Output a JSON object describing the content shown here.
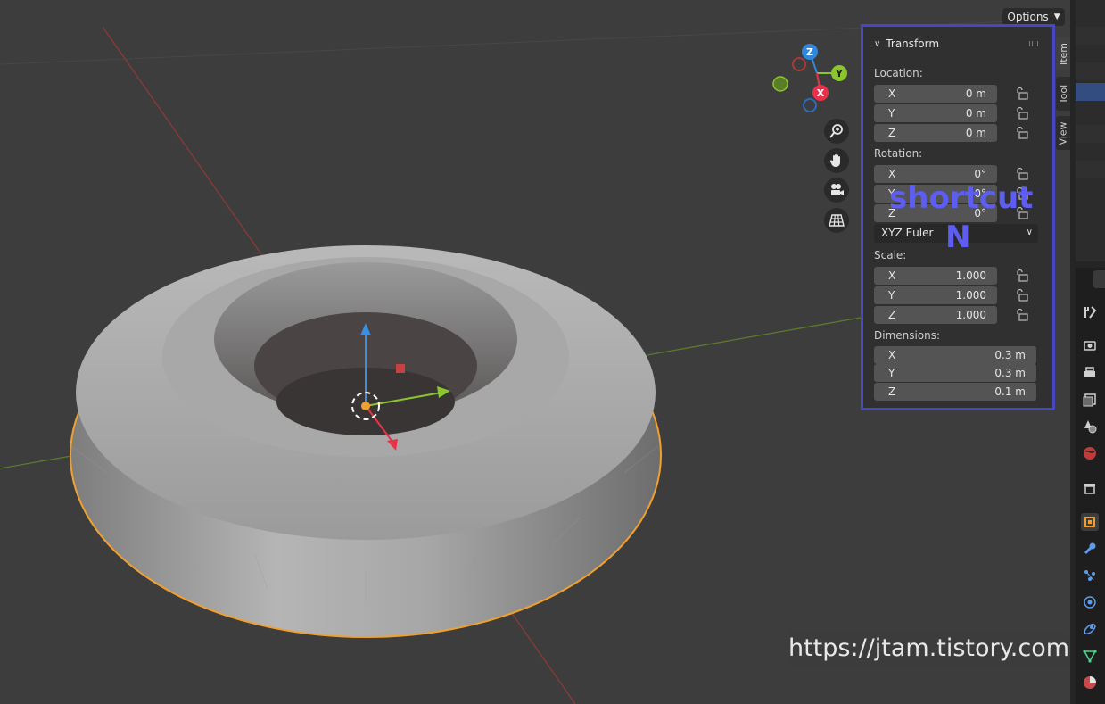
{
  "header": {
    "options_label": "Options"
  },
  "transform": {
    "title": "Transform",
    "location": {
      "label": "Location:",
      "x": "0 m",
      "y": "0 m",
      "z": "0 m"
    },
    "rotation": {
      "label": "Rotation:",
      "x": "0°",
      "y": "0°",
      "z": "0°"
    },
    "rotation_mode": "XYZ Euler",
    "scale": {
      "label": "Scale:",
      "x": "1.000",
      "y": "1.000",
      "z": "1.000"
    },
    "dimensions": {
      "label": "Dimensions:",
      "x": "0.3 m",
      "y": "0.3 m",
      "z": "0.1 m"
    },
    "axis": {
      "x": "X",
      "y": "Y",
      "z": "Z"
    }
  },
  "annotation": {
    "line1": "shortcut",
    "line2": "N"
  },
  "tabs": {
    "item": "Item",
    "tool": "Tool",
    "view": "View"
  },
  "gizmo": {
    "x": "X",
    "y": "Y",
    "z": "Z"
  },
  "watermark": "https://jtam.tistory.com",
  "colors": {
    "highlight_border": "#4747c4",
    "annotation_text": "#5d5df2",
    "selection_outline": "#f0a030",
    "axis_x": "#e8324c",
    "axis_y": "#8bc62d",
    "axis_z": "#2f87e0"
  },
  "icons": {
    "view_tools": [
      "zoom-icon",
      "hand-pan-icon",
      "camera-icon",
      "grid-perspective-icon"
    ]
  }
}
